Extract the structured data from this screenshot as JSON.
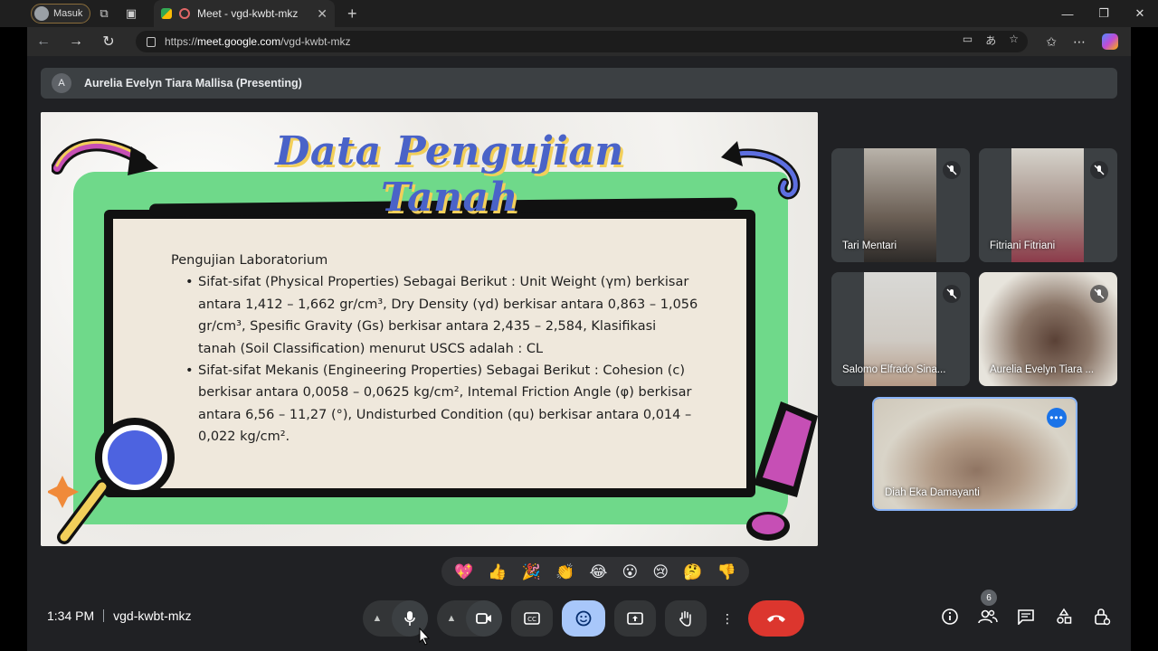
{
  "browser": {
    "profile_label": "Masuk",
    "tab_title": "Meet - vgd-kwbt-mkz",
    "tab_close": "✕",
    "new_tab": "+",
    "url_prefix": "https://",
    "url_host": "meet.google.com",
    "url_path": "/vgd-kwbt-mkz"
  },
  "meet": {
    "presenter_initial": "A",
    "presenting_banner": "Aurelia Evelyn Tiara Mallisa (Presenting)",
    "time": "1:34 PM",
    "meeting_code": "vgd-kwbt-mkz",
    "participant_count": "6"
  },
  "slide": {
    "title": "Data Pengujian Tanah",
    "heading": "Pengujian Laboratorium",
    "bullets": [
      {
        "lines": [
          "Sifat-sifat (Physical Properties) Sebagai Berikut : Unit Weight (γm) berkisar",
          "antara 1,412 – 1,662 gr/cm³, Dry Density (γd) berkisar antara 0,863 – 1,056",
          "gr/cm³, Spesific Gravity (Gs) berkisar antara 2,435 – 2,584, Klasifikasi",
          "tanah (Soil Classification) menurut USCS adalah : CL"
        ]
      },
      {
        "lines": [
          "Sifat-sifat Mekanis (Engineering Properties) Sebagai Berikut : Cohesion (c)",
          "berkisar antara 0,0058 – 0,0625 kg/cm², Intemal Friction Angle (φ) berkisar",
          "antara 6,56 – 11,27 (°), Undisturbed Condition (qu) berkisar antara 0,014 –",
          "0,022 kg/cm²."
        ]
      }
    ]
  },
  "participants": [
    {
      "name": "Tari Mentari",
      "muted": true
    },
    {
      "name": "Fitriani Fitriani",
      "muted": true
    },
    {
      "name": "Salomo Elfrado Sina...",
      "muted": true
    },
    {
      "name": "Aurelia Evelyn Tiara ...",
      "muted": true
    },
    {
      "name": "Diah Eka Damayanti",
      "muted": false,
      "active": true
    }
  ],
  "reactions": [
    "💖",
    "👍",
    "🎉",
    "👏",
    "😂",
    "😮",
    "😢",
    "🤔",
    "👎"
  ],
  "colors": {
    "meet_bg": "#202124",
    "hangup_red": "#dc362e",
    "active_blue": "#a8c7fa",
    "slide_title": "#4a63c8",
    "slide_green": "#6fd98a"
  }
}
